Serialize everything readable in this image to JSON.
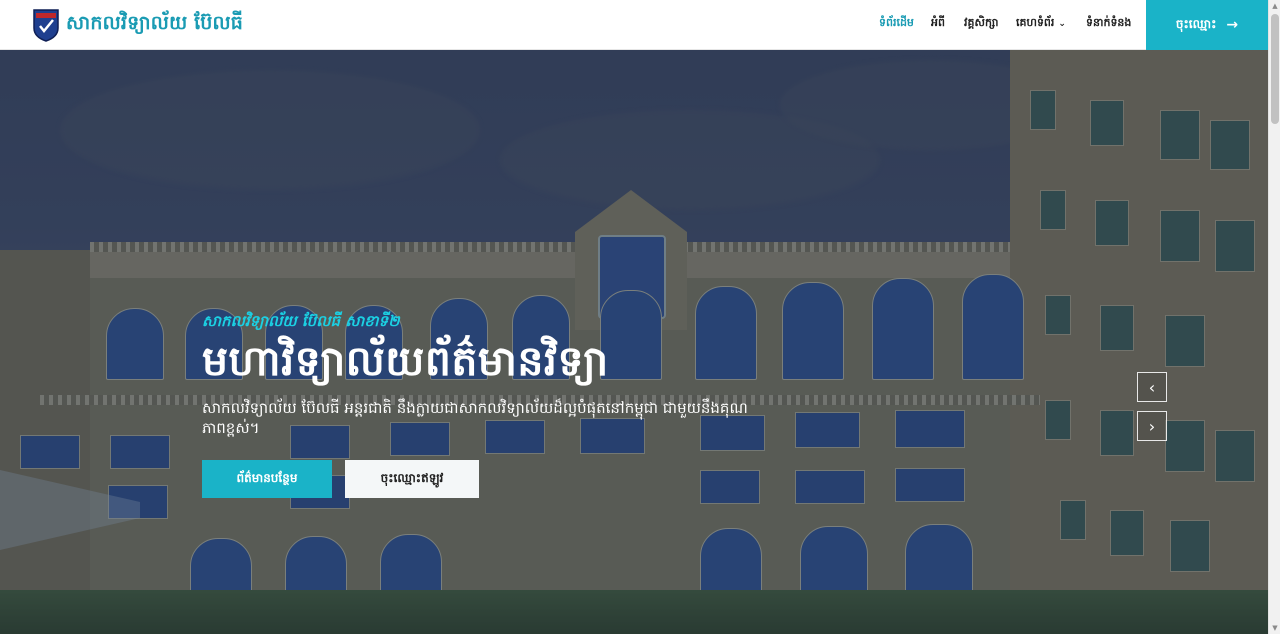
{
  "navbar": {
    "brand_name": "សាកលវិទ្យាល័យ ប៊ែលធី",
    "menu": [
      {
        "label": "ទំព័រដើម",
        "active": true
      },
      {
        "label": "អំពី",
        "active": false
      },
      {
        "label": "វគ្គសិក្សា",
        "active": false
      },
      {
        "label": "គេហទំព័រ",
        "active": false,
        "dropdown": true
      },
      {
        "label": "ទំនាក់ទំនង",
        "active": false
      }
    ],
    "cta_label": "ចុះឈ្មោះ",
    "accent_color": "#1ab3c8"
  },
  "hero": {
    "subtitle": "សាកលវិទ្យាល័យ ប៊ែលធី សាខាទី២",
    "title": "មហាវិទ្យាល័យព័ត៌មានវិទ្យា",
    "description": "សាកលវិទ្យាល័យ ប៊ែលធី អន្តរជាតិ នឹងក្លាយជាសាកលវិទ្យាល័យដ៏ល្អបំផុតនៅកម្ពុជា ជាមួយនឹងគុណភាពខ្ពស់។",
    "primary_button": "ព័ត៌មានបន្ថែម",
    "secondary_button": "ចុះឈ្មោះឥឡូវ",
    "prev_icon": "chevron-left-icon",
    "next_icon": "chevron-right-icon"
  },
  "icons": {
    "brand_logo": "university-shield-logo",
    "cta_arrow": "arrow-right-icon",
    "dropdown": "chevron-down-icon"
  }
}
